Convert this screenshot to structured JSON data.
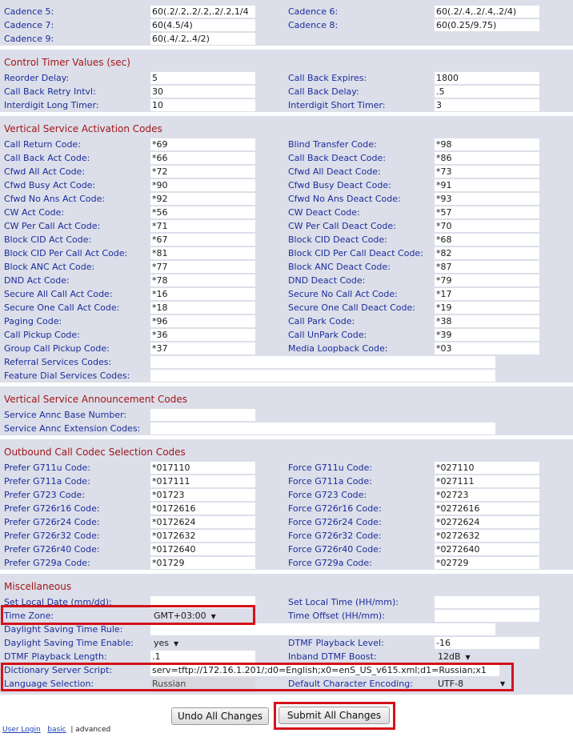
{
  "cadence": [
    {
      "label1": "Cadence 5:",
      "value1": "60(.2/.2,.2/.2,.2/.2,1/4",
      "label2": "Cadence 6:",
      "value2": "60(.2/.4,.2/.4,.2/4)"
    },
    {
      "label1": "Cadence 7:",
      "value1": "60(4.5/4)",
      "label2": "Cadence 8:",
      "value2": "60(0.25/9.75)"
    },
    {
      "label1": "Cadence 9:",
      "value1": "60(.4/.2,.4/2)"
    }
  ],
  "control_timer": {
    "title": "Control Timer Values (sec)",
    "rows": [
      {
        "label1": "Reorder Delay:",
        "value1": "5",
        "label2": "Call Back Expires:",
        "value2": "1800"
      },
      {
        "label1": "Call Back Retry Intvl:",
        "value1": "30",
        "label2": "Call Back Delay:",
        "value2": ".5"
      },
      {
        "label1": "Interdigit Long Timer:",
        "value1": "10",
        "label2": "Interdigit Short Timer:",
        "value2": "3"
      }
    ]
  },
  "vsac": {
    "title": "Vertical Service Activation Codes",
    "rows": [
      {
        "label1": "Call Return Code:",
        "value1": "*69",
        "label2": "Blind Transfer Code:",
        "value2": "*98"
      },
      {
        "label1": "Call Back Act Code:",
        "value1": "*66",
        "label2": "Call Back Deact Code:",
        "value2": "*86"
      },
      {
        "label1": "Cfwd All Act Code:",
        "value1": "*72",
        "label2": "Cfwd All Deact Code:",
        "value2": "*73"
      },
      {
        "label1": "Cfwd Busy Act Code:",
        "value1": "*90",
        "label2": "Cfwd Busy Deact Code:",
        "value2": "*91"
      },
      {
        "label1": "Cfwd No Ans Act Code:",
        "value1": "*92",
        "label2": "Cfwd No Ans Deact Code:",
        "value2": "*93"
      },
      {
        "label1": "CW Act Code:",
        "value1": "*56",
        "label2": "CW Deact Code:",
        "value2": "*57"
      },
      {
        "label1": "CW Per Call Act Code:",
        "value1": "*71",
        "label2": "CW Per Call Deact Code:",
        "value2": "*70"
      },
      {
        "label1": "Block CID Act Code:",
        "value1": "*67",
        "label2": "Block CID Deact Code:",
        "value2": "*68"
      },
      {
        "label1": "Block CID Per Call Act Code:",
        "value1": "*81",
        "label2": "Block CID Per Call Deact Code:",
        "value2": "*82"
      },
      {
        "label1": "Block ANC Act Code:",
        "value1": "*77",
        "label2": "Block ANC Deact Code:",
        "value2": "*87"
      },
      {
        "label1": "DND Act Code:",
        "value1": "*78",
        "label2": "DND Deact Code:",
        "value2": "*79"
      },
      {
        "label1": "Secure All Call Act Code:",
        "value1": "*16",
        "label2": "Secure No Call Act Code:",
        "value2": "*17"
      },
      {
        "label1": "Secure One Call Act Code:",
        "value1": "*18",
        "label2": "Secure One Call Deact Code:",
        "value2": "*19"
      },
      {
        "label1": "Paging Code:",
        "value1": "*96",
        "label2": "Call Park Code:",
        "value2": "*38"
      },
      {
        "label1": "Call Pickup Code:",
        "value1": "*36",
        "label2": "Call UnPark Code:",
        "value2": "*39"
      },
      {
        "label1": "Group Call Pickup Code:",
        "value1": "*37",
        "label2": "Media Loopback Code:",
        "value2": "*03"
      }
    ],
    "wide_rows": [
      {
        "label": "Referral Services Codes:",
        "value": ""
      },
      {
        "label": "Feature Dial Services Codes:",
        "value": ""
      }
    ]
  },
  "vsann": {
    "title": "Vertical Service Announcement Codes",
    "rows": [
      {
        "label": "Service Annc Base Number:",
        "value": ""
      },
      {
        "label": "Service Annc Extension Codes:",
        "value": ""
      }
    ]
  },
  "codec": {
    "title": "Outbound Call Codec Selection Codes",
    "rows": [
      {
        "label1": "Prefer G711u Code:",
        "value1": "*017110",
        "label2": "Force G711u Code:",
        "value2": "*027110"
      },
      {
        "label1": "Prefer G711a Code:",
        "value1": "*017111",
        "label2": "Force G711a Code:",
        "value2": "*027111"
      },
      {
        "label1": "Prefer G723 Code:",
        "value1": "*01723",
        "label2": "Force G723 Code:",
        "value2": "*02723"
      },
      {
        "label1": "Prefer G726r16 Code:",
        "value1": "*0172616",
        "label2": "Force G726r16 Code:",
        "value2": "*0272616"
      },
      {
        "label1": "Prefer G726r24 Code:",
        "value1": "*0172624",
        "label2": "Force G726r24 Code:",
        "value2": "*0272624"
      },
      {
        "label1": "Prefer G726r32 Code:",
        "value1": "*0172632",
        "label2": "Force G726r32 Code:",
        "value2": "*0272632"
      },
      {
        "label1": "Prefer G726r40 Code:",
        "value1": "*0172640",
        "label2": "Force G726r40 Code:",
        "value2": "*0272640"
      },
      {
        "label1": "Prefer G729a Code:",
        "value1": "*01729",
        "label2": "Force G729a Code:",
        "value2": "*02729"
      }
    ]
  },
  "misc": {
    "title": "Miscellaneous",
    "set_local_date": {
      "label": "Set Local Date (mm/dd):",
      "value": ""
    },
    "set_local_time": {
      "label": "Set Local Time (HH/mm):",
      "value": ""
    },
    "time_zone": {
      "label": "Time Zone:",
      "value": "GMT+03:00"
    },
    "time_offset": {
      "label": "Time Offset (HH/mm):",
      "value": ""
    },
    "dst_rule": {
      "label": "Daylight Saving Time Rule:",
      "value": ""
    },
    "dst_enable": {
      "label": "Daylight Saving Time Enable:",
      "value": "yes"
    },
    "dtmf_level": {
      "label": "DTMF Playback Level:",
      "value": "-16"
    },
    "dtmf_length": {
      "label": "DTMF Playback Length:",
      "value": ".1"
    },
    "inband_boost": {
      "label": "Inband DTMF Boost:",
      "value": "12dB"
    },
    "dict_script": {
      "label": "Dictionary Server Script:",
      "value": "serv=tftp://172.16.1.201/;d0=English;x0=enS_US_v615.xml;d1=Russian;x1"
    },
    "language": {
      "label": "Language Selection:",
      "value": "Russian"
    },
    "encoding": {
      "label": "Default Character Encoding:",
      "value": "UTF-8"
    }
  },
  "buttons": {
    "undo": "Undo All Changes",
    "submit": "Submit All Changes"
  },
  "footer": {
    "user_login": "User Login",
    "basic": "basic",
    "separator": "|",
    "advanced": "advanced"
  },
  "colors": {
    "row_bg": "#dcdfe9",
    "label": "#1b2c9c",
    "section": "#a0161a",
    "highlight": "#d3121a"
  }
}
